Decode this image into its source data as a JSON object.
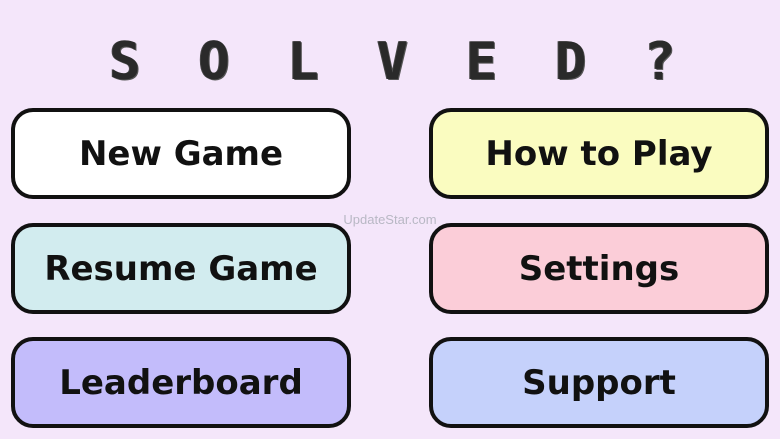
{
  "title": {
    "letters": [
      "S",
      "O",
      "L",
      "V",
      "E",
      "D",
      "?"
    ]
  },
  "buttons": {
    "new_game": "New Game",
    "how_to_play": "How to Play",
    "resume_game": "Resume Game",
    "settings": "Settings",
    "leaderboard": "Leaderboard",
    "support": "Support"
  },
  "watermark": "UpdateStar.com",
  "colors": {
    "background": "#f4e6fa",
    "new_game": "#ffffff",
    "how_to_play": "#fafcc0",
    "resume_game": "#d2ecef",
    "settings": "#fbcdd8",
    "leaderboard": "#c3bcfb",
    "support": "#c5d1fb",
    "border": "#111111"
  }
}
